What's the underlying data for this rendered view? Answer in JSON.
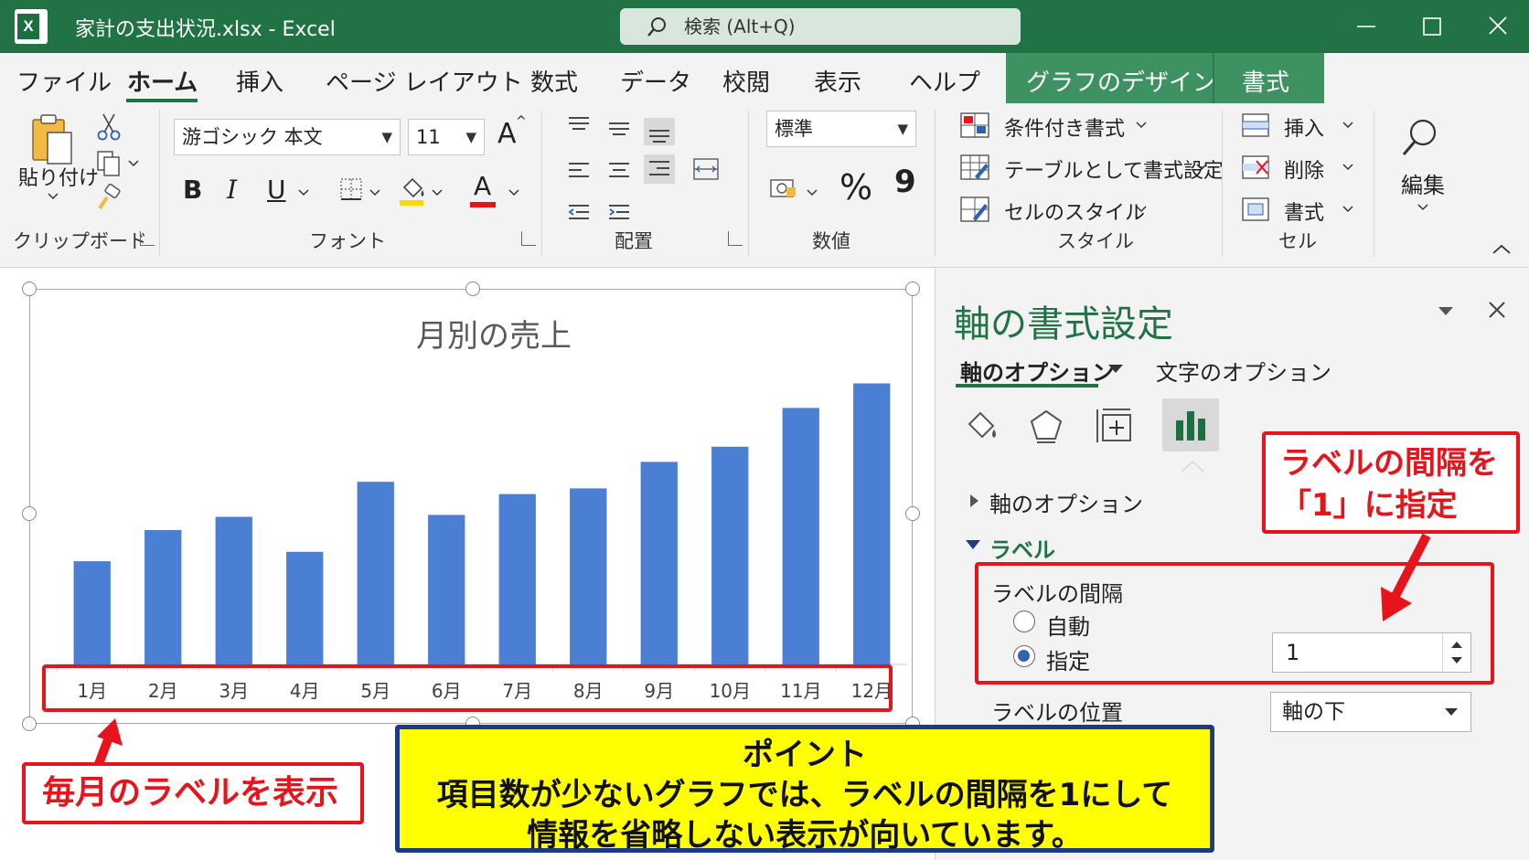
{
  "window": {
    "title": "家計の支出状況.xlsx  -  Excel",
    "search_placeholder": "検索 (Alt+Q)",
    "logo_letter": "X"
  },
  "menu": {
    "tabs": [
      "ファイル",
      "ホーム",
      "挿入",
      "ページ レイアウト",
      "数式",
      "データ",
      "校閲",
      "表示",
      "ヘルプ"
    ],
    "context_tabs": [
      "グラフのデザイン",
      "書式"
    ]
  },
  "ribbon": {
    "clipboard": {
      "paste": "貼り付け",
      "group": "クリップボード"
    },
    "font": {
      "name": "游ゴシック 本文",
      "size": "11",
      "grow": "A",
      "bold": "B",
      "italic": "I",
      "underline": "U",
      "color_letter": "A",
      "group": "フォント"
    },
    "alignment": {
      "group": "配置"
    },
    "number": {
      "format": "標準",
      "percent": "%",
      "comma": "9",
      "group": "数値"
    },
    "styles": {
      "conditional": "条件付き書式",
      "table": "テーブルとして書式設定",
      "cell_styles": "セルのスタイル",
      "group": "スタイル"
    },
    "cells": {
      "insert": "挿入",
      "delete": "削除",
      "format": "書式",
      "group": "セル"
    },
    "editing": {
      "label": "編集"
    }
  },
  "chart_data": {
    "type": "bar",
    "title": "月別の売上",
    "categories": [
      "1月",
      "2月",
      "3月",
      "4月",
      "5月",
      "6月",
      "7月",
      "8月",
      "9月",
      "10月",
      "11月",
      "12月"
    ],
    "values": [
      109,
      142,
      156,
      119,
      193,
      158,
      180,
      186,
      214,
      230,
      271,
      297
    ],
    "ylim": [
      0,
      310
    ],
    "bar_color": "#4a7fd4",
    "grid": false,
    "legend": "none"
  },
  "panel": {
    "title": "軸の書式設定",
    "tab_axis": "軸のオプション",
    "tab_text": "文字のオプション",
    "section_axis": "軸のオプション",
    "section_label": "ラベル",
    "interval_label": "ラベルの間隔",
    "auto": "自動",
    "specify": "指定",
    "interval_value": "1",
    "position_label": "ラベルの位置",
    "position_value": "軸の下"
  },
  "annotations": {
    "callout_interval": [
      "ラベルの間隔を",
      "「1」に指定"
    ],
    "callout_monthly": "毎月のラベルを表示",
    "point_heading": "ポイント",
    "point_lines": [
      "項目数が少ないグラフでは、ラベルの間隔を1にして",
      "情報を省略しない表示が向いています。"
    ]
  },
  "colors": {
    "excel_green": "#217346",
    "callout_red": "#e8141b",
    "point_yellow": "#ffff00",
    "point_border": "#1d3a8a"
  }
}
